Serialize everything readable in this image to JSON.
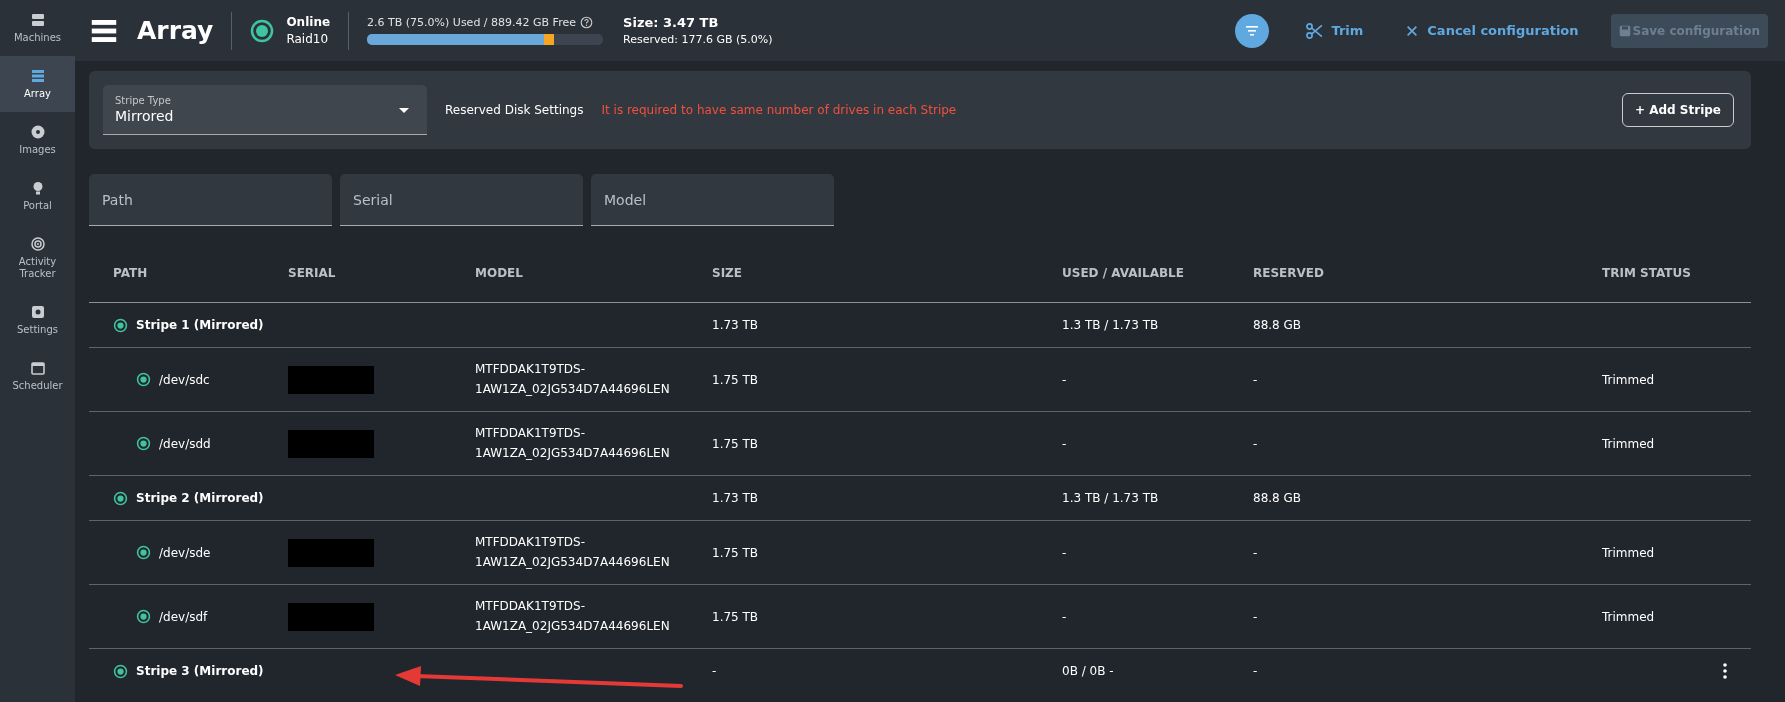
{
  "sidebar": {
    "items": [
      {
        "label": "Machines",
        "selected": false
      },
      {
        "label": "Array",
        "selected": true
      },
      {
        "label": "Images",
        "selected": false
      },
      {
        "label": "Portal",
        "selected": false
      },
      {
        "label": "Activity Tracker",
        "selected": false
      },
      {
        "label": "Settings",
        "selected": false
      },
      {
        "label": "Scheduler",
        "selected": false
      }
    ]
  },
  "header": {
    "title": "Array",
    "status": "Online",
    "raid": "Raid10",
    "usage_text": "2.6 TB (75.0%) Used / 889.42 GB Free",
    "usage": {
      "level": 0.75
    },
    "size": "Size: 3.47 TB",
    "reserved": "Reserved: 177.6 GB (5.0%)",
    "actions": [
      {
        "label": "Trim",
        "kind": "trim",
        "disabled": false
      },
      {
        "label": "Cancel configuration",
        "kind": "cancel",
        "disabled": false
      },
      {
        "label": "Save configuration",
        "kind": "save",
        "disabled": true
      }
    ]
  },
  "settings": {
    "stripe_type": {
      "label": "Stripe Type",
      "value": "Mirrored"
    },
    "reserved_label": "Reserved Disk Settings",
    "warning": "It is required to have same number of drives in each Stripe",
    "add_button": "+ Add Stripe"
  },
  "filters": [
    {
      "placeholder": "Path"
    },
    {
      "placeholder": "Serial"
    },
    {
      "placeholder": "Model"
    }
  ],
  "table": {
    "columns": [
      "PATH",
      "SERIAL",
      "MODEL",
      "SIZE",
      "USED / AVAILABLE",
      "RESERVED",
      "TRIM STATUS"
    ],
    "rows": [
      {
        "kind": "stripe",
        "path": "Stripe 1 (Mirrored)",
        "size": "1.73 TB",
        "used": "1.3 TB / 1.73 TB",
        "reserved": "88.8 GB",
        "menu": false
      },
      {
        "kind": "disk",
        "path": "/dev/sdc",
        "model": "MTFDDAK1T9TDS-1AW1ZA_02JG534D7A44696LEN",
        "size": "1.75 TB",
        "used": "-",
        "reserved": "-",
        "trim": "Trimmed",
        "menu": false
      },
      {
        "kind": "disk",
        "path": "/dev/sdd",
        "model": "MTFDDAK1T9TDS-1AW1ZA_02JG534D7A44696LEN",
        "size": "1.75 TB",
        "used": "-",
        "reserved": "-",
        "trim": "Trimmed",
        "menu": false
      },
      {
        "kind": "stripe",
        "path": "Stripe 2 (Mirrored)",
        "size": "1.73 TB",
        "used": "1.3 TB / 1.73 TB",
        "reserved": "88.8 GB",
        "menu": false
      },
      {
        "kind": "disk",
        "path": "/dev/sde",
        "model": "MTFDDAK1T9TDS-1AW1ZA_02JG534D7A44696LEN",
        "size": "1.75 TB",
        "used": "-",
        "reserved": "-",
        "trim": "Trimmed",
        "menu": false
      },
      {
        "kind": "disk",
        "path": "/dev/sdf",
        "model": "MTFDDAK1T9TDS-1AW1ZA_02JG534D7A44696LEN",
        "size": "1.75 TB",
        "used": "-",
        "reserved": "-",
        "trim": "Trimmed",
        "menu": false
      },
      {
        "kind": "stripe",
        "path": "Stripe 3 (Mirrored)",
        "size": "-",
        "used": "0B / 0B -",
        "reserved": "-",
        "menu": true
      }
    ]
  }
}
